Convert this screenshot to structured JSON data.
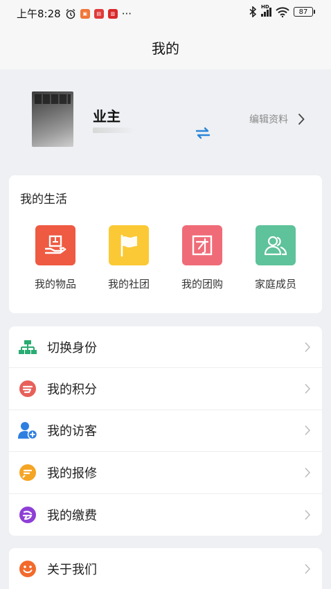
{
  "status_bar": {
    "time": "上午8:28",
    "more": "···",
    "signal": "HD",
    "battery": "87"
  },
  "nav": {
    "title": "我的"
  },
  "profile": {
    "name": "业主",
    "edit_label": "编辑资料"
  },
  "life": {
    "title": "我的生活",
    "items": [
      {
        "label": "我的物品",
        "icon": "goods-icon",
        "color": "#ee5a42"
      },
      {
        "label": "我的社团",
        "icon": "flag-icon",
        "color": "#fbc935"
      },
      {
        "label": "我的团购",
        "icon": "group-buy-icon",
        "color": "#f06b78"
      },
      {
        "label": "家庭成员",
        "icon": "family-icon",
        "color": "#5ec29a"
      }
    ]
  },
  "menu": [
    {
      "label": "切换身份",
      "icon": "org-chart-icon",
      "color": "#2aab72"
    },
    {
      "label": "我的积分",
      "icon": "points-icon",
      "color": "#e8605a"
    },
    {
      "label": "我的访客",
      "icon": "visitor-icon",
      "color": "#2e7fe0"
    },
    {
      "label": "我的报修",
      "icon": "repair-icon",
      "color": "#f5a524"
    },
    {
      "label": "我的缴费",
      "icon": "payment-icon",
      "color": "#8e3fd6"
    }
  ],
  "menu2": [
    {
      "label": "关于我们",
      "icon": "smiley-icon",
      "color": "#f26a2c"
    }
  ]
}
